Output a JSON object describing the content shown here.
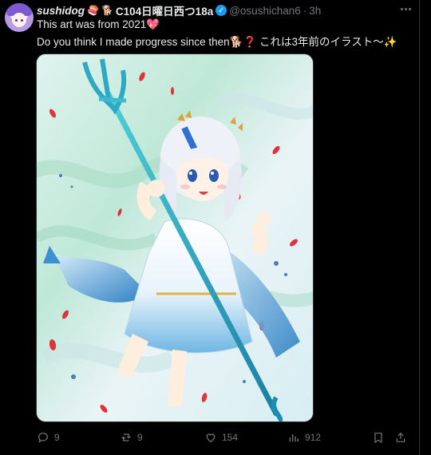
{
  "tweet": {
    "author_name": "sushidog",
    "author_extra": "C104日曜日西つ18a",
    "name_emoji_1": "🍣",
    "name_emoji_2": "🐕",
    "handle": "@osushichan6",
    "separator": "·",
    "time": "3h",
    "text_line1": "This art was from 2021",
    "text_line1_emoji": "💖",
    "text_line2_a": "Do you think I made progress since then",
    "text_line2_emoji1": "🐕",
    "text_line2_emoji2": "❓",
    "text_line2_b": "これは3年前のイラスト〜",
    "text_line2_emoji3": "✨"
  },
  "actions": {
    "replies": "9",
    "reposts": "9",
    "likes": "154",
    "views": "912"
  },
  "icons": [
    "reply-icon",
    "repost-icon",
    "like-icon",
    "views-icon",
    "bookmark-icon",
    "share-icon",
    "verified-icon",
    "more-icon"
  ],
  "colors": {
    "background": "#000000",
    "text": "#e7e9ea",
    "muted": "#71767b",
    "verified": "#1d9bf0",
    "border": "#2f3336"
  }
}
